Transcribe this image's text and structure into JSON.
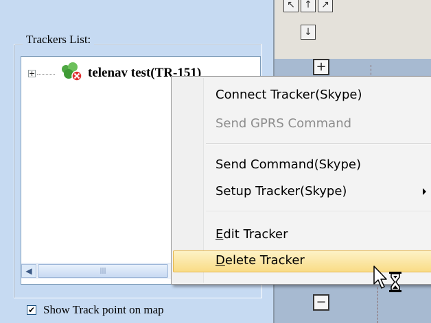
{
  "trackers_panel": {
    "group_title": "Trackers List:",
    "tree": {
      "expander": "+",
      "item_label": "telenav test(TR-151)"
    },
    "show_track_points": {
      "checked": true,
      "label": "Show Track point on map"
    }
  },
  "map_controls": {
    "zoom_in": "+",
    "zoom_out": "−",
    "pan_down": "↓"
  },
  "context_menu": {
    "items": [
      {
        "label": "Connect Tracker(Skype)",
        "enabled": true
      },
      {
        "label": "Send GPRS Command",
        "enabled": false
      },
      {
        "label": "Send Command(Skype)",
        "enabled": true
      },
      {
        "label": "Setup Tracker(Skype)",
        "enabled": true,
        "has_submenu": true
      },
      {
        "label_accel": "E",
        "label_rest": "dit Tracker",
        "enabled": true
      },
      {
        "label_accel": "D",
        "label_rest": "elete Tracker",
        "enabled": true,
        "highlighted": true
      }
    ]
  },
  "colors": {
    "panel_background": "#c6daf2",
    "menu_highlight": "#f9dc86",
    "disabled_text": "#8d8d8d"
  }
}
